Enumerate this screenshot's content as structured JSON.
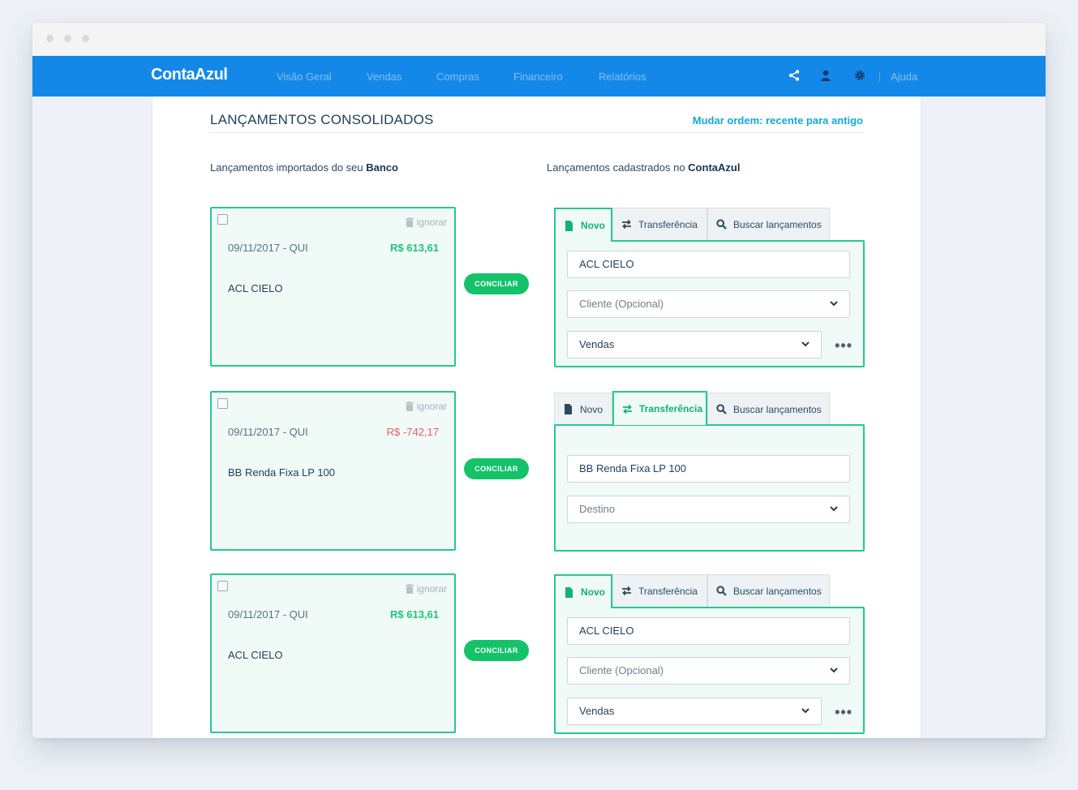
{
  "nav": {
    "logo": "ContaAzul",
    "items": [
      "Visão Geral",
      "Vendas",
      "Compras",
      "Financeiro",
      "Relatórios"
    ],
    "help": "Ajuda",
    "icons": [
      "share-icon",
      "user-icon",
      "gear-icon"
    ]
  },
  "page": {
    "title": "LANÇAMENTOS CONSOLIDADOS",
    "order_link": "Mudar ordem: recente para antigo",
    "left_label_prefix": "Lançamentos importados do seu ",
    "left_label_bold": "Banco",
    "right_label_prefix": "Lançamentos cadastrados no ",
    "right_label_bold": "ContaAzul"
  },
  "colors": {
    "primary": "#1488e8",
    "accent_green": "#27c892",
    "positive": "#22c27e",
    "negative": "#ef5a6b",
    "link": "#13a9d2"
  },
  "tabs": {
    "novo": "Novo",
    "transferencia": "Transferência",
    "buscar": "Buscar lançamentos"
  },
  "entries": [
    {
      "ignore": "ignorar",
      "date": "09/11/2017 - QUI",
      "amount": "R$ 613,61",
      "description": "ACL CIELO",
      "button": "CONCILIAR",
      "active_tab": "novo",
      "fields": {
        "description": "ACL CIELO",
        "cliente_placeholder": "Cliente (Opcional)",
        "categoria": "Vendas",
        "more": "•••"
      }
    },
    {
      "ignore": "ignorar",
      "date": "09/11/2017 - QUI",
      "amount": "R$ -742,17",
      "description": "BB Renda Fixa LP 100",
      "button": "CONCILIAR",
      "active_tab": "transferencia",
      "fields": {
        "description": "BB Renda Fixa LP 100",
        "destino_placeholder": "Destino"
      }
    },
    {
      "ignore": "ignorar",
      "date": "09/11/2017 - QUI",
      "amount": "R$ 613,61",
      "description": "ACL CIELO",
      "button": "CONCILIAR",
      "active_tab": "novo",
      "fields": {
        "description": "ACL CIELO",
        "cliente_placeholder": "Cliente (Opcional)",
        "categoria": "Vendas",
        "more": "•••"
      }
    }
  ]
}
